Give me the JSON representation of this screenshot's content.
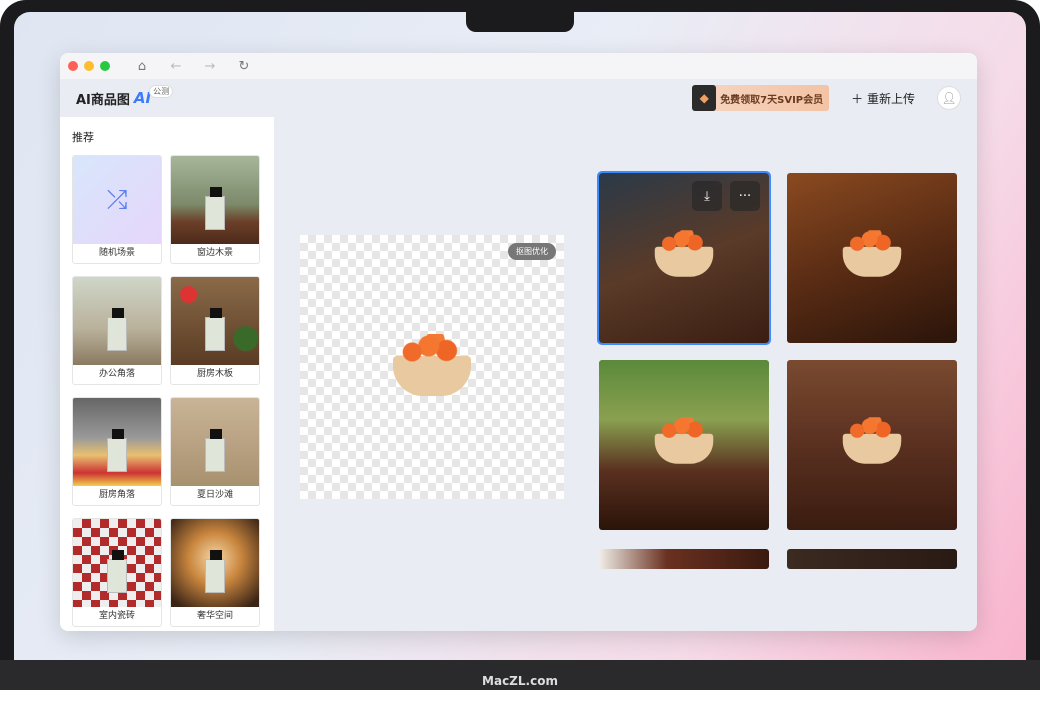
{
  "window": {
    "app_name": "AI商品图",
    "ai_badge": "AI",
    "beta_badge": "公测"
  },
  "header": {
    "vip_label": "免费领取7天SVIP会员",
    "reupload_label": "重新上传"
  },
  "sidebar": {
    "title": "推荐",
    "scenes": [
      {
        "label": "随机场景"
      },
      {
        "label": "窗边木景"
      },
      {
        "label": "办公角落"
      },
      {
        "label": "厨房木板"
      },
      {
        "label": "厨房角落"
      },
      {
        "label": "夏日沙滩"
      },
      {
        "label": "室内瓷砖"
      },
      {
        "label": "奢华空间"
      }
    ]
  },
  "editor": {
    "optimize_label": "抠图优化"
  },
  "footer": {
    "brand": "MacZL.com"
  },
  "colors": {
    "accent": "#3a8bff"
  }
}
